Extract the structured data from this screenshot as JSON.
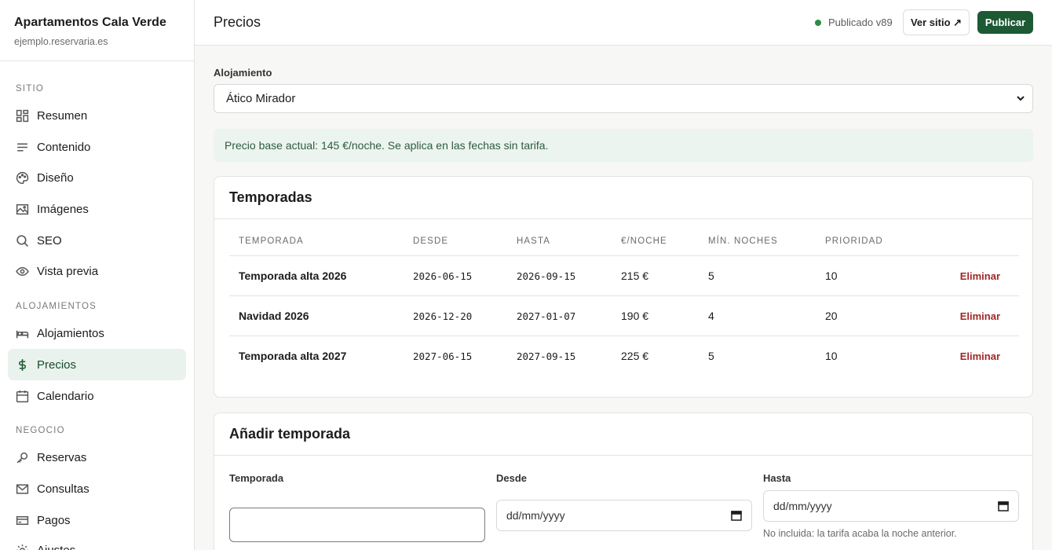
{
  "sidebar": {
    "brand_name": "Apartamentos Cala Verde",
    "brand_domain": "ejemplo.reservaria.es",
    "sections": [
      {
        "label": "Sitio"
      },
      {
        "label": "Alojamientos"
      },
      {
        "label": "Negocio"
      }
    ],
    "items": [
      {
        "label": "Resumen",
        "icon": "grid-icon"
      },
      {
        "label": "Contenido",
        "icon": "text-lines-icon"
      },
      {
        "label": "Diseño",
        "icon": "palette-icon"
      },
      {
        "label": "Imágenes",
        "icon": "image-icon"
      },
      {
        "label": "SEO",
        "icon": "search-icon"
      },
      {
        "label": "Vista previa",
        "icon": "eye-icon"
      },
      {
        "label": "Alojamientos",
        "icon": "bed-icon"
      },
      {
        "label": "Precios",
        "icon": "dollar-icon",
        "active": true
      },
      {
        "label": "Calendario",
        "icon": "calendar-icon"
      },
      {
        "label": "Reservas",
        "icon": "key-icon"
      },
      {
        "label": "Consultas",
        "icon": "mail-icon"
      },
      {
        "label": "Pagos",
        "icon": "card-icon"
      },
      {
        "label": "Ajustes",
        "icon": "gear-icon"
      }
    ]
  },
  "header": {
    "title": "Precios",
    "status": "Publicado v89",
    "view_site_label": "Ver sitio ↗",
    "publish_label": "Publicar"
  },
  "main": {
    "accommodation_label": "Alojamiento",
    "accommodation_value": "Ático Mirador",
    "info_text": "Precio base actual: 145 €/noche. Se aplica en las fechas sin tarifa.",
    "seasons": {
      "title": "Temporadas",
      "columns": [
        "Temporada",
        "Desde",
        "Hasta",
        "€/noche",
        "Mín. noches",
        "Prioridad"
      ],
      "rows": [
        {
          "name": "Temporada alta 2026",
          "from": "2026-06-15",
          "to": "2026-09-15",
          "price": "215 €",
          "min_nights": "5",
          "priority": "10",
          "delete_label": "Eliminar"
        },
        {
          "name": "Navidad 2026",
          "from": "2026-12-20",
          "to": "2027-01-07",
          "price": "190 €",
          "min_nights": "4",
          "priority": "20",
          "delete_label": "Eliminar"
        },
        {
          "name": "Temporada alta 2027",
          "from": "2027-06-15",
          "to": "2027-09-15",
          "price": "225 €",
          "min_nights": "5",
          "priority": "10",
          "delete_label": "Eliminar"
        }
      ]
    },
    "add_season": {
      "title": "Añadir temporada",
      "name_label": "Temporada",
      "name_value": "",
      "from_label": "Desde",
      "from_placeholder": "dd/mm/yyyy",
      "to_label": "Hasta",
      "to_placeholder": "dd/mm/yyyy",
      "to_hint": "No incluida: la tarifa acaba la noche anterior."
    }
  },
  "colors": {
    "accent": "#1d5a34",
    "active_bg": "#e9f2ec",
    "status_dot": "#2e8b47",
    "danger": "#a32626"
  }
}
